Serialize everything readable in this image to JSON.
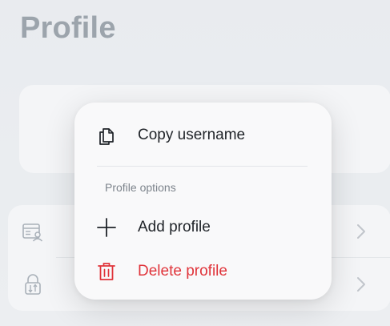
{
  "page": {
    "title": "Profile"
  },
  "context_menu": {
    "copy_username_label": "Copy username",
    "section_header": "Profile options",
    "add_profile_label": "Add profile",
    "delete_profile_label": "Delete profile"
  },
  "icons": {
    "copy": "copy-icon",
    "add": "plus-icon",
    "delete": "trash-icon",
    "row1": "id-card-icon",
    "row2": "lock-import-icon",
    "chevron": "chevron-right-icon"
  },
  "colors": {
    "title": "#5e6a75",
    "destructive": "#e0343a",
    "menu_background": "#f9f9fa",
    "text": "#1f2328"
  }
}
